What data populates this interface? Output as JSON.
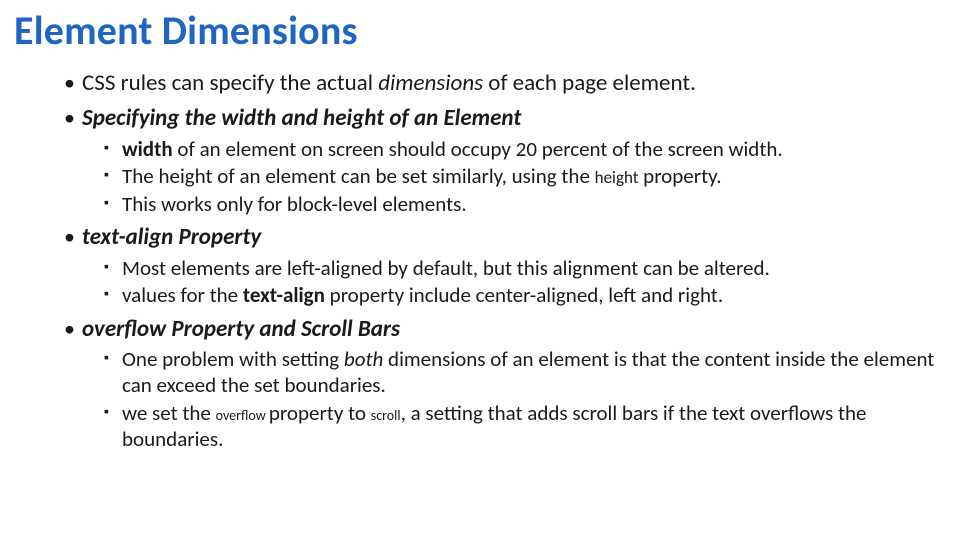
{
  "title": "Element Dimensions",
  "bullets": {
    "b1a_pre": "CSS rules can specify the actual ",
    "b1a_em": "dimensions",
    "b1a_post": " of each page element.",
    "b1b": "Specifying the width and height of an Element",
    "s1a_b": "width ",
    "s1a_rest": "of an element on screen should occupy 20 percent of the screen width.",
    "s1b_pre": "The height of an element can be set similarly, using the ",
    "s1b_kw": "height",
    "s1b_post": " property.",
    "s1c": "This works only for block-level elements.",
    "b2": "text-align Property",
    "s2a": "Most elements are left-aligned by default, but this alignment can be altered.",
    "s2b_pre": "values for the ",
    "s2b_kw": "text-align ",
    "s2b_post": "property include center-aligned, left and right.",
    "b3": "overflow Property and Scroll Bars",
    "s3a_pre": "One problem with setting ",
    "s3a_em": "both",
    "s3a_post": " dimensions of an element is that the content inside the element can exceed the set boundaries.",
    "s3b_pre": "we set the ",
    "s3b_kw1": "overflow ",
    "s3b_mid": "property to ",
    "s3b_kw2": "scroll",
    "s3b_post": ", a setting that adds scroll bars if the text overflows the boundaries."
  }
}
